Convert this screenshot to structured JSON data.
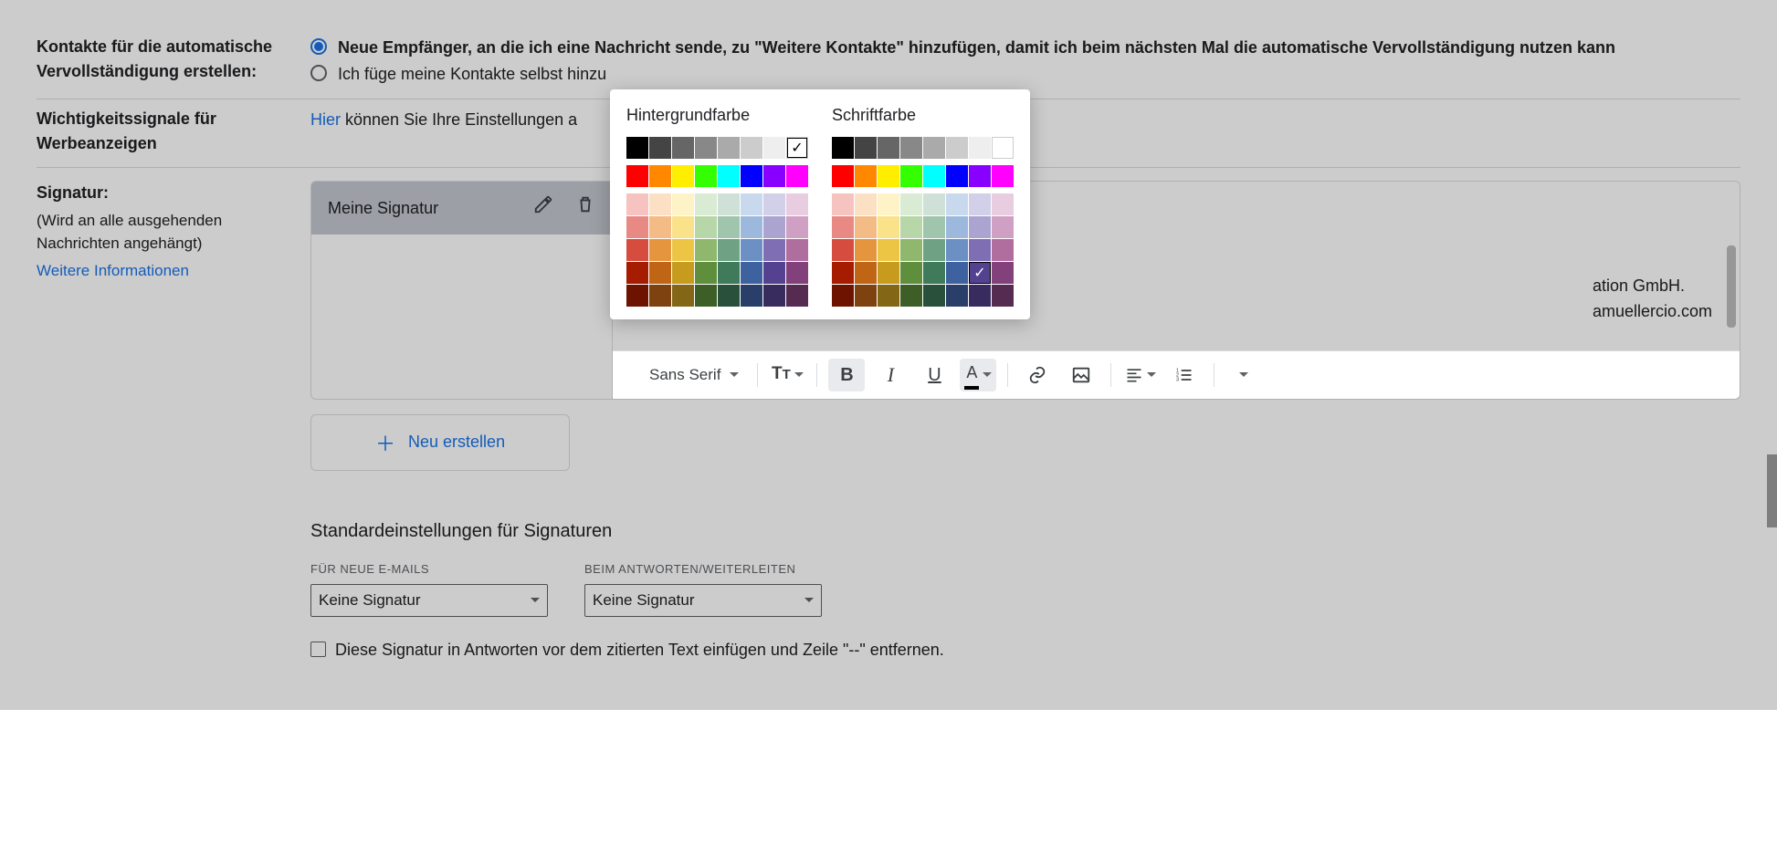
{
  "autocomplete": {
    "label": "Kontakte für die automatische Vervollständigung erstellen:",
    "opt1": "Neue Empfänger, an die ich eine Nachricht sende, zu \"Weitere Kontakte\" hinzufügen, damit ich beim nächsten Mal die automatische Vervollständigung nutzen kann",
    "opt2": "Ich füge meine Kontakte selbst hinzu"
  },
  "ads": {
    "label": "Wichtigkeitssignale für Werbeanzeigen",
    "link": "Hier",
    "text": " können Sie Ihre Einstellungen a"
  },
  "signature": {
    "label": "Signatur:",
    "note": "(Wird an alle ausgehenden Nachrichten angehängt)",
    "more": "Weitere Informationen",
    "item_name": "Meine Signatur",
    "content_line1": "ation GmbH.",
    "content_line2": "amuellercio.com",
    "new_btn": "Neu erstellen",
    "font": "Sans Serif"
  },
  "colorpicker": {
    "bg_title": "Hintergrundfarbe",
    "fg_title": "Schriftfarbe",
    "row1": [
      "#000000",
      "#444444",
      "#666666",
      "#888888",
      "#aaaaaa",
      "#cccccc",
      "#eeeeee",
      "#ffffff"
    ],
    "row2": [
      "#ff0000",
      "#ff8800",
      "#ffee00",
      "#33ff00",
      "#00ffff",
      "#0000ff",
      "#8800ff",
      "#ff00ff"
    ],
    "pastel": [
      [
        "#f6c3c0",
        "#fbe0c3",
        "#fdf3c6",
        "#d9ebd3",
        "#cfe0d6",
        "#c9d9ed",
        "#d2cfe8",
        "#e8cde0"
      ],
      [
        "#e88a83",
        "#f3bb85",
        "#f9e28a",
        "#b7d7a8",
        "#a0c5ad",
        "#9db8dd",
        "#aba3d0",
        "#cfa0c3"
      ],
      [
        "#d64c3e",
        "#e6953f",
        "#edc545",
        "#8fb86e",
        "#6fa284",
        "#6c8fc4",
        "#7f6eb3",
        "#b06e9f"
      ],
      [
        "#a61c00",
        "#c06415",
        "#c79c1e",
        "#5f8f3d",
        "#3f7a5a",
        "#3e61a0",
        "#54418f",
        "#82417a"
      ],
      [
        "#6e1300",
        "#7d4210",
        "#836616",
        "#3e5e28",
        "#29503b",
        "#293f6a",
        "#382b5e",
        "#562b51"
      ]
    ],
    "bg_selected": "0_7",
    "fg_selected": "p_3_6"
  },
  "defaults": {
    "title": "Standardeinstellungen für Signaturen",
    "new_label": "FÜR NEUE E-MAILS",
    "reply_label": "BEIM ANTWORTEN/WEITERLEITEN",
    "value": "Keine Signatur",
    "cb_label": "Diese Signatur in Antworten vor dem zitierten Text einfügen und Zeile \"--\" entfernen."
  }
}
